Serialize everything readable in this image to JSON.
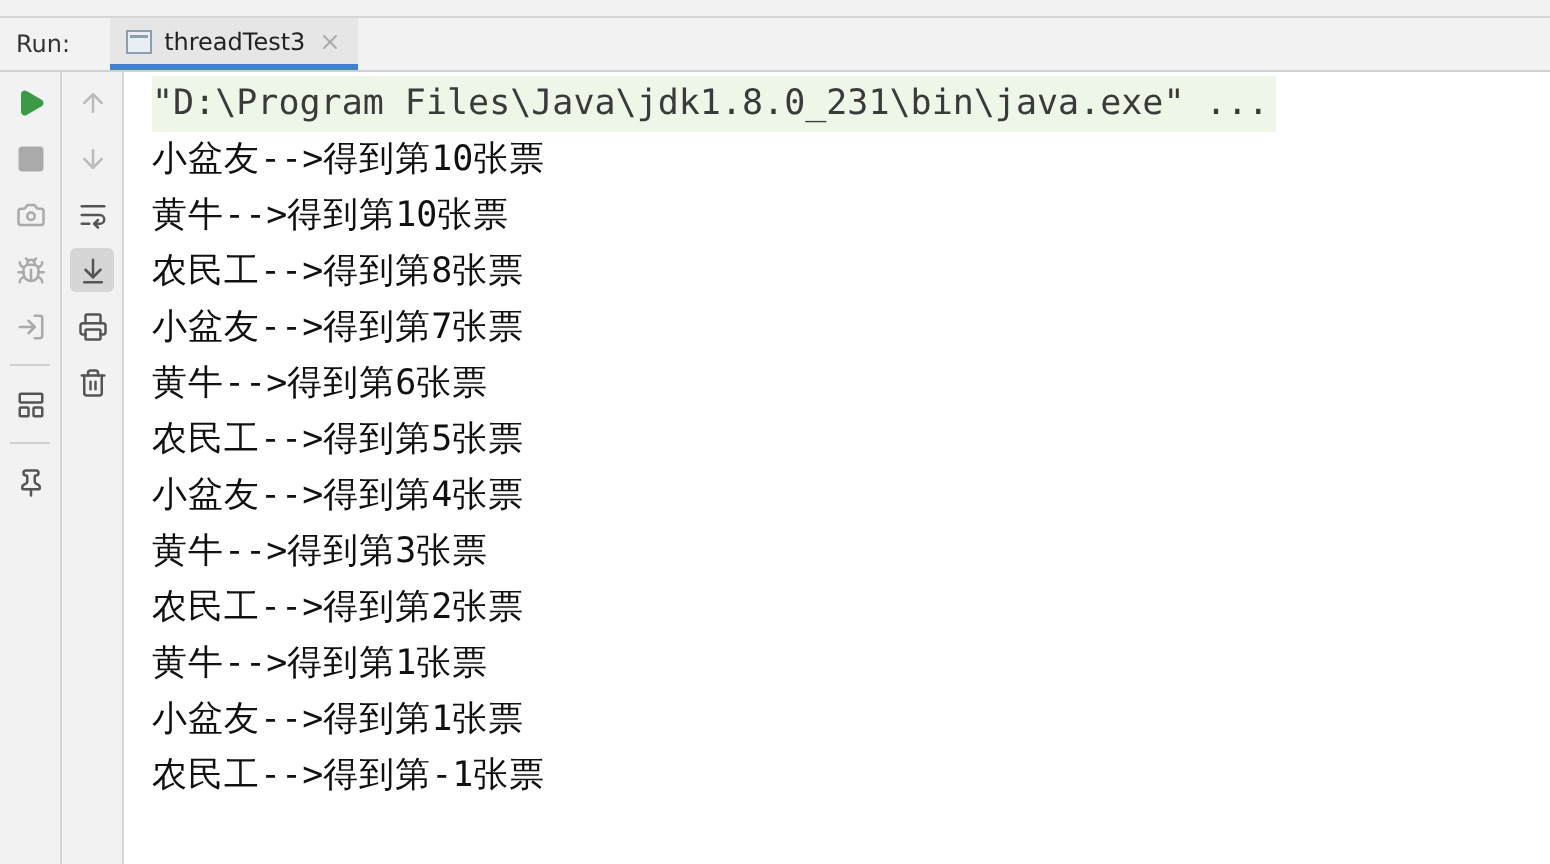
{
  "run_panel": {
    "label": "Run:",
    "tabs": [
      {
        "label": "threadTest3",
        "selected": true
      }
    ]
  },
  "left_toolbar": [
    [
      {
        "kind": "run"
      },
      {
        "kind": "stop"
      },
      {
        "kind": "camera"
      },
      {
        "kind": "debug"
      },
      {
        "kind": "login"
      }
    ],
    [
      {
        "kind": "layout"
      }
    ],
    [
      {
        "kind": "pin"
      }
    ]
  ],
  "right_toolbar": [
    {
      "kind": "up",
      "selected": false
    },
    {
      "kind": "down",
      "selected": false
    },
    {
      "kind": "wrap",
      "selected": false
    },
    {
      "kind": "scroll_end",
      "selected": true
    },
    {
      "kind": "print",
      "selected": false
    },
    {
      "kind": "trash",
      "selected": false
    }
  ],
  "console": {
    "command": "\"D:\\Program Files\\Java\\jdk1.8.0_231\\bin\\java.exe\" ...",
    "lines": [
      "小盆友-->得到第10张票",
      "黄牛-->得到第10张票",
      "农民工-->得到第8张票",
      "小盆友-->得到第7张票",
      "黄牛-->得到第6张票",
      "农民工-->得到第5张票",
      "小盆友-->得到第4张票",
      "黄牛-->得到第3张票",
      "农民工-->得到第2张票",
      "黄牛-->得到第1张票",
      "小盆友-->得到第1张票",
      "农民工-->得到第-1张票"
    ]
  }
}
